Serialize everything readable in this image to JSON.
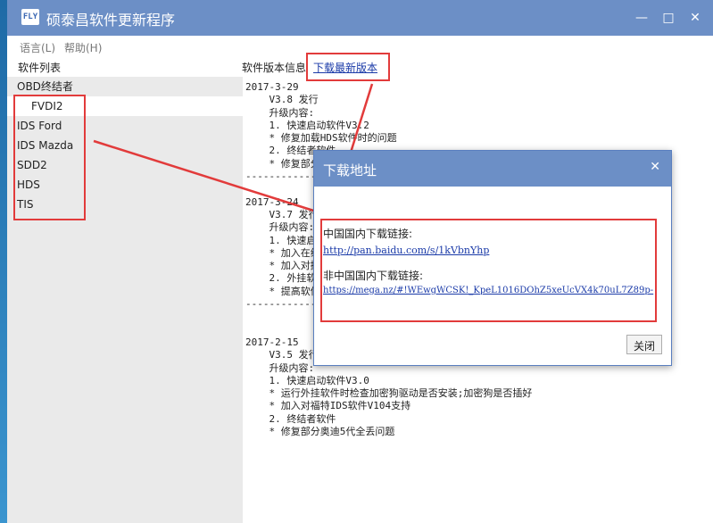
{
  "window": {
    "logo_text": "FLY",
    "title": "硕泰昌软件更新程序",
    "minimize": "—",
    "maximize": "□",
    "close": "✕"
  },
  "menu": [
    "语言(L)",
    "帮助(H)"
  ],
  "headers": {
    "software_list": "软件列表",
    "version_info": "软件版本信息",
    "download_latest": "下载最新版本"
  },
  "software_list": [
    {
      "label": "OBD终结者",
      "selected": false,
      "child": false
    },
    {
      "label": "FVDI2",
      "selected": true,
      "child": true
    },
    {
      "label": "IDS Ford",
      "selected": false,
      "child": false
    },
    {
      "label": "IDS Mazda",
      "selected": false,
      "child": false
    },
    {
      "label": "SDD2",
      "selected": false,
      "child": false
    },
    {
      "label": "HDS",
      "selected": false,
      "child": false
    },
    {
      "label": "TIS",
      "selected": false,
      "child": false
    }
  ],
  "version_info_lines": [
    "2017-3-29",
    "    V3.8 发行",
    "    升级内容:",
    "    1. 快速启动软件V3.2",
    "    * 修复加载HDS软件时的问题",
    "    2. 终结者软件",
    "    * 修复部分",
    "-------------------------------------",
    "",
    "2017-3-24",
    "    V3.7 发行",
    "    升级内容:",
    "    1. 快速启",
    "    * 加入在线",
    "    * 加入对捷",
    "    2. 外挂软",
    "    * 提高软件",
    "-------------------------------------",
    "",
    "",
    "2017-2-15",
    "    V3.5 发行",
    "    升级内容:",
    "    1. 快速启动软件V3.0",
    "    * 运行外挂软件时检查加密狗驱动是否安装;加密狗是否插好",
    "    * 加入对福特IDS软件V104支持",
    "    2. 终结者软件",
    "    * 修复部分奥迪5代全丢问题"
  ],
  "dialog": {
    "title": "下载地址",
    "close": "✕",
    "domestic_label": "中国国内下载链接:",
    "domestic_url": "http://pan.baidu.com/s/1kVbnYhp",
    "foreign_label": "非中国国内下载链接:",
    "foreign_url": "https://mega.nz/#!WEwgWCSK!_KpeL1016DOhZ5xeUcVX4k70uL7Z89p-",
    "close_button": "关闭"
  },
  "colors": {
    "titlebar": "#6c8fc6",
    "highlight_box": "#e23b3b",
    "link": "#1a3aa8"
  }
}
